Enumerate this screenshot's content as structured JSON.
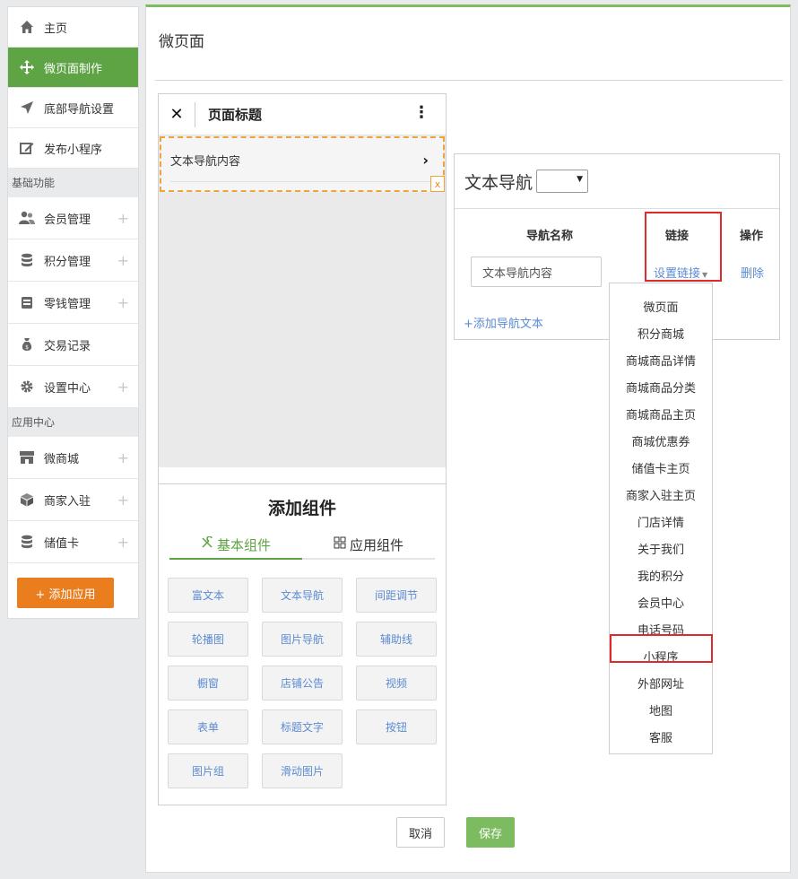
{
  "sidebar": {
    "items": [
      {
        "label": "主页",
        "icon": "home-icon"
      },
      {
        "label": "微页面制作",
        "icon": "move-arrows-icon",
        "active": true
      },
      {
        "label": "底部导航设置",
        "icon": "navigation-arrow-icon"
      },
      {
        "label": "发布小程序",
        "icon": "edit-icon"
      }
    ],
    "section_basic": "基础功能",
    "basic_items": [
      {
        "label": "会员管理",
        "icon": "users-icon"
      },
      {
        "label": "积分管理",
        "icon": "database-icon"
      },
      {
        "label": "零钱管理",
        "icon": "wallet-icon"
      },
      {
        "label": "交易记录",
        "icon": "money-bag-icon"
      },
      {
        "label": "设置中心",
        "icon": "gear-icon"
      }
    ],
    "section_app": "应用中心",
    "app_items": [
      {
        "label": "微商城",
        "icon": "store-icon"
      },
      {
        "label": "商家入驻",
        "icon": "box-icon"
      },
      {
        "label": "储值卡",
        "icon": "database-icon"
      }
    ],
    "plus_glyph": "+",
    "add_app_button": "+ 添加应用"
  },
  "main": {
    "title": "微页面"
  },
  "phone": {
    "close_glyph": "✕",
    "title": "页面标题",
    "more_glyph": "⋮",
    "nav_text_item": "文本导航内容",
    "chevron_glyph": "›",
    "delete_glyph": "x"
  },
  "components": {
    "title": "添加组件",
    "tabs": [
      {
        "label": "基本组件",
        "active": true
      },
      {
        "label": "应用组件"
      }
    ],
    "buttons": [
      "富文本",
      "文本导航",
      "间距调节",
      "轮播图",
      "图片导航",
      "辅助线",
      "橱窗",
      "店铺公告",
      "视频",
      "表单",
      "标题文字",
      "按钮",
      "图片组",
      "滑动图片"
    ]
  },
  "config": {
    "title": "文本导航",
    "select_value": "",
    "col_name": "导航名称",
    "col_link": "链接",
    "col_action": "操作",
    "name_value": "文本导航内容",
    "set_link": "设置链接",
    "delete": "删除",
    "add_nav_text": "+添加导航文本"
  },
  "dropdown": {
    "options": [
      "微页面",
      "积分商城",
      "商城商品详情",
      "商城商品分类",
      "商城商品主页",
      "商城优惠券",
      "储值卡主页",
      "商家入驻主页",
      "门店详情",
      "关于我们",
      "我的积分",
      "会员中心",
      "电话号码",
      "小程序",
      "外部网址",
      "地图",
      "客服"
    ],
    "highlighted": "小程序"
  },
  "footer": {
    "cancel": "取消",
    "save": "保存"
  },
  "colors": {
    "accent_green": "#5ea344",
    "orange": "#ea7d1e",
    "link_blue": "#5b8bd1",
    "highlight_red": "#e02a2a"
  }
}
